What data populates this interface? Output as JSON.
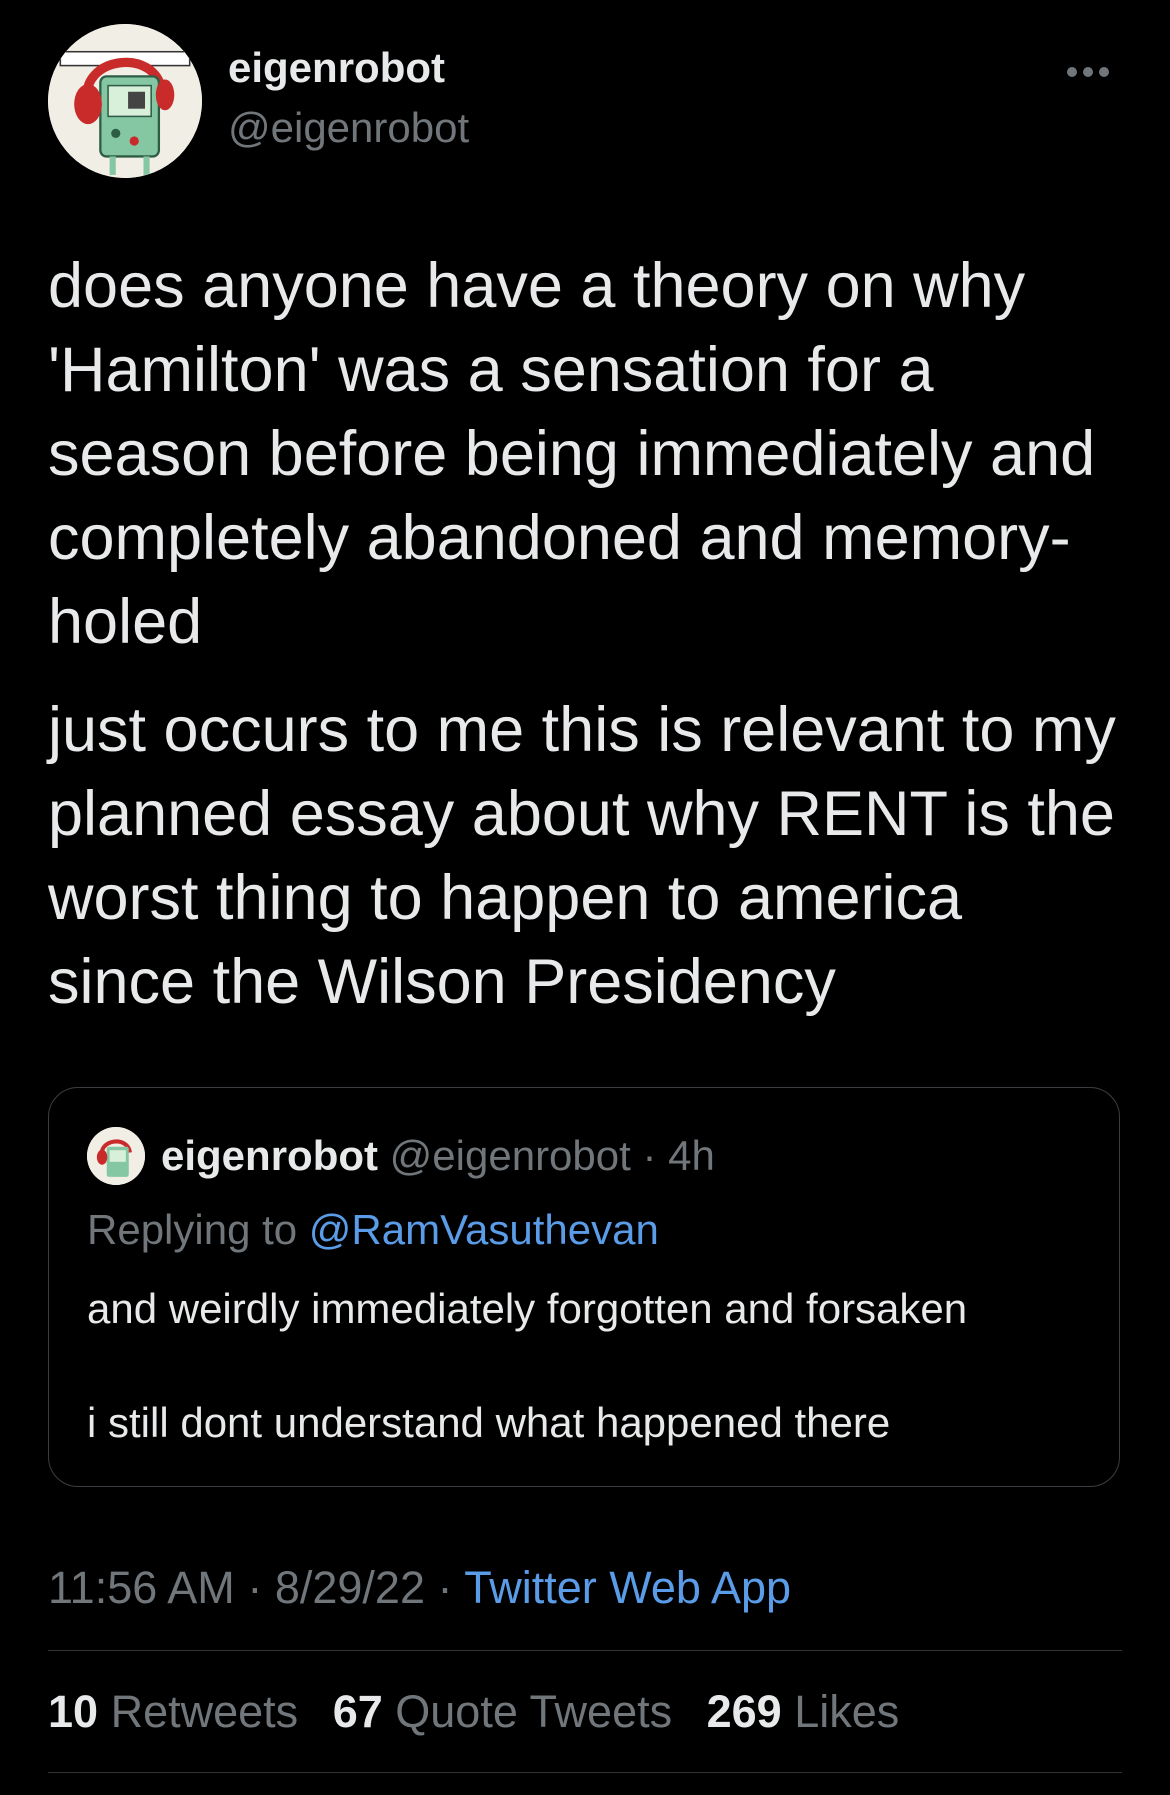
{
  "tweet": {
    "author_name": "eigenrobot",
    "author_handle": "@eigenrobot",
    "text_paragraphs": [
      "does anyone have a theory on why 'Hamilton' was a sensation for a season before being immediately and completely abandoned and memory-holed",
      "just occurs to me this is relevant to my planned essay about why RENT is the worst thing to happen to america since the Wilson Presidency"
    ],
    "time": "11:56 AM",
    "date": "8/29/22",
    "source": "Twitter Web App",
    "separator": "·"
  },
  "quoted_tweet": {
    "author_name": "eigenrobot",
    "author_handle": "@eigenrobot",
    "age": "4h",
    "replying_to_label": "Replying to",
    "replying_to_handle": "@RamVasuthevan",
    "text_paragraphs": [
      "and weirdly immediately forgotten and forsaken",
      "i still dont understand what happened there"
    ]
  },
  "stats": {
    "retweets_count": "10",
    "retweets_label": "Retweets",
    "quotes_count": "67",
    "quotes_label": "Quote Tweets",
    "likes_count": "269",
    "likes_label": "Likes"
  },
  "icons": {
    "more": "more-horizontal-icon",
    "avatar": "bmo-headphones-avatar"
  },
  "colors": {
    "background": "#000000",
    "text_primary": "#e7e9ea",
    "text_secondary": "#71767b",
    "link": "#5a9ce8",
    "border": "#3a3e42"
  }
}
